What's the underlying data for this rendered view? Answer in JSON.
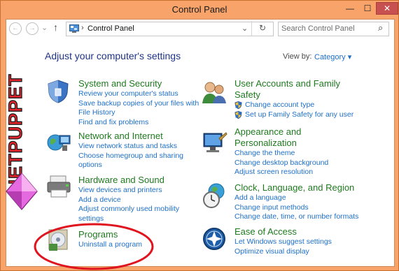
{
  "window": {
    "title": "Control Panel",
    "min": "—",
    "max": "☐",
    "close": "✕"
  },
  "nav": {
    "back": "←",
    "forward": "→",
    "recent": "⌄",
    "up": "↑",
    "sep": "›",
    "path": "Control Panel",
    "dropdown": "⌄",
    "refresh": "↻"
  },
  "search": {
    "placeholder": "Search Control Panel",
    "icon": "⌕"
  },
  "main": {
    "heading": "Adjust your computer's settings",
    "view_by_label": "View by:",
    "view_by_value": "Category ▾"
  },
  "categories": {
    "system": {
      "title": "System and Security",
      "links": [
        "Review your computer's status",
        "Save backup copies of your files with",
        "File History",
        "Find and fix problems"
      ]
    },
    "network": {
      "title": "Network and Internet",
      "links": [
        "View network status and tasks",
        "Choose homegroup and sharing",
        "options"
      ]
    },
    "hardware": {
      "title": "Hardware and Sound",
      "links": [
        "View devices and printers",
        "Add a device",
        "Adjust commonly used mobility",
        "settings"
      ]
    },
    "programs": {
      "title": "Programs",
      "links": [
        "Uninstall a program"
      ]
    },
    "users": {
      "title_line1": "User Accounts and Family",
      "title_line2": "Safety",
      "links": [
        "Change account type",
        "Set up Family Safety for any user"
      ]
    },
    "appearance": {
      "title_line1": "Appearance and",
      "title_line2": "Personalization",
      "links": [
        "Change the theme",
        "Change desktop background",
        "Adjust screen resolution"
      ]
    },
    "clock": {
      "title": "Clock, Language, and Region",
      "links": [
        "Add a language",
        "Change input methods",
        "Change date, time, or number formats"
      ]
    },
    "ease": {
      "title": "Ease of Access",
      "links": [
        "Let Windows suggest settings",
        "Optimize visual display"
      ]
    }
  },
  "watermark": {
    "text": "NETPUPPET"
  },
  "colors": {
    "title_green": "#1f7a1f",
    "link_blue": "#1e6fc8",
    "heading_navy": "#1e3287",
    "frame": "#f7a36a",
    "highlight_ring": "#e0141e"
  }
}
